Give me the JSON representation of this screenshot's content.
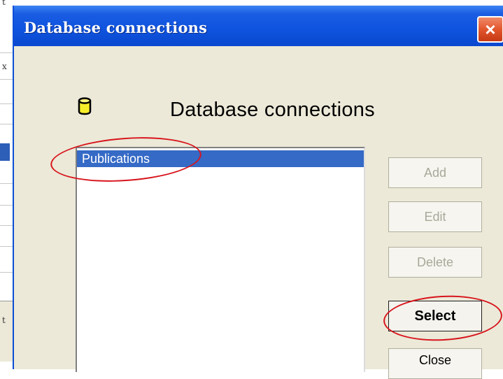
{
  "dialog": {
    "title": "Database connections",
    "close_glyph": "×",
    "heading": "Database connections",
    "icon": "database-cylinder-icon"
  },
  "list": {
    "items": [
      {
        "label": "Publications",
        "selected": true
      }
    ]
  },
  "buttons": {
    "add": "Add",
    "edit": "Edit",
    "delete": "Delete",
    "select": "Select",
    "close": "Close"
  },
  "background_app": {
    "glyphs": [
      "t",
      "x",
      "t"
    ]
  },
  "colors": {
    "titlebar": "#0a48cf",
    "face": "#ece9d8",
    "selection": "#356ac6",
    "annotation": "#d8141c"
  }
}
